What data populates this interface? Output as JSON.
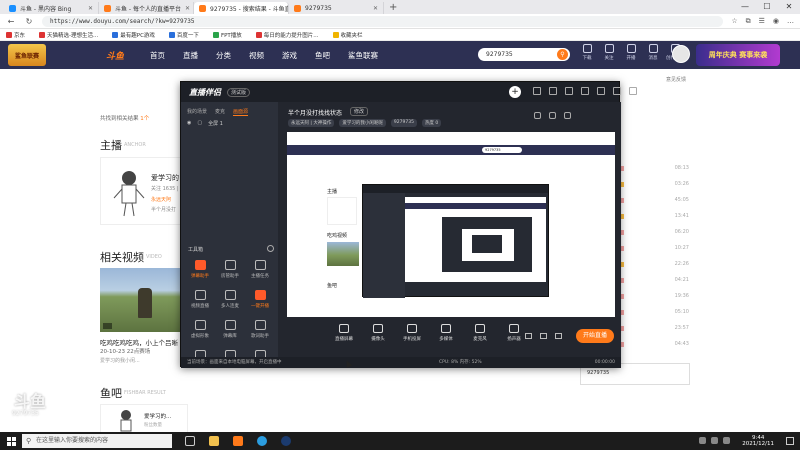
{
  "browser": {
    "tabs": [
      {
        "label": "斗鱼 - 黑内容 Bing",
        "active": false
      },
      {
        "label": "斗鱼 - 每个人的直播平台",
        "active": false
      },
      {
        "label": "9279735 - 搜索结果 - 斗鱼直播",
        "active": true
      },
      {
        "label": "9279735",
        "active": false
      }
    ],
    "url": "https://www.douyu.com/search/?kw=9279735",
    "bookmarks": [
      "京东",
      "天猫精选-理想生活...",
      "最有趣PC游戏",
      "百度一下",
      "FPT播放",
      "每日的能力提升图片...",
      "收藏夹栏"
    ]
  },
  "site": {
    "badge": "鲨鱼联赛",
    "logo": "斗鱼",
    "nav": [
      "首页",
      "直播",
      "分类",
      "视频",
      "游戏",
      "鱼吧",
      "鲨鱼联赛"
    ],
    "search_value": "9279735",
    "header_icons": [
      "下载",
      "关注",
      "开播",
      "消息",
      "创作中心"
    ],
    "promo": "周年庆典 赛事来袭",
    "feedback": "意见反馈",
    "result_count_prefix": "共找到相关结果",
    "result_count_value": "1个",
    "anchor_title": "主播",
    "anchor_sub": "ANCHOR",
    "anchor_name": "爱学习的",
    "anchor_fans": "关注 1635 | 热度",
    "anchor_room": "永远天阿",
    "anchor_desc": "半个月没打",
    "video_title": "相关视频",
    "video_sub": "VIDEO",
    "video_name": "吃鸡吃鸡吃鸡，小上个吕晰",
    "video_date": "20-10-23 22点赛场",
    "video_author": "爱学习的我小闲...",
    "fishbar_title": "鱼吧",
    "fishbar_sub": "FISHBAR RESULT",
    "fish_name": "爱学习的...",
    "fish_sub": "粉丝数量",
    "rank_values": [
      "08:13",
      "03:26",
      "45:05",
      "13:41",
      "06:20",
      "10:27",
      "22:26",
      "04:21",
      "19:36",
      "05:10",
      "23:57",
      "04:43"
    ],
    "right_input": "9279735",
    "watermark": "斗鱼",
    "watermark_sub": "9279735"
  },
  "app": {
    "title": "直播伴侣",
    "version": "测试版",
    "side_tabs": [
      "我的场景",
      "麦克",
      "画面源"
    ],
    "scene_label": "全屏 1",
    "tools_label": "工具箱",
    "tools": [
      {
        "label": "弹幕助手",
        "on": true
      },
      {
        "label": "房管助手",
        "on": false
      },
      {
        "label": "主播任务",
        "on": false
      },
      {
        "label": "视频直播",
        "on": false
      },
      {
        "label": "多人连麦",
        "on": false
      },
      {
        "label": "一键开播",
        "on": true
      },
      {
        "label": "虚拟形象",
        "on": false
      },
      {
        "label": "弹幕库",
        "on": false
      },
      {
        "label": "歌词助手",
        "on": false
      },
      {
        "label": "连线",
        "on": false
      },
      {
        "label": "直播回放",
        "on": false
      },
      {
        "label": "更多工具",
        "on": false
      }
    ],
    "live_title": "半个月没打找找状态",
    "edit_label": "修改",
    "tags": [
      "永远天阿 | 大神操作",
      "爱学习的我小闲呢呢",
      "9279735",
      "热度 0"
    ],
    "preview_search": "9279735",
    "preview_section1": "主播",
    "preview_section2": "吃鸡视频",
    "preview_section3": "鱼吧",
    "controls": [
      "直播屏幕",
      "摄像头",
      "手机投屏",
      "多媒体",
      "麦克风",
      "扬声器"
    ],
    "golive": "开始直播",
    "status_left": "当前场景：画面来自本地电脑屏幕，开启直播中",
    "status_mid": "CPU: 8%  内存: 52%",
    "status_right": "00:00:00"
  },
  "taskbar": {
    "search_placeholder": "在这里输入你要搜索的内容",
    "time": "9:44",
    "date": "2021/12/11"
  }
}
